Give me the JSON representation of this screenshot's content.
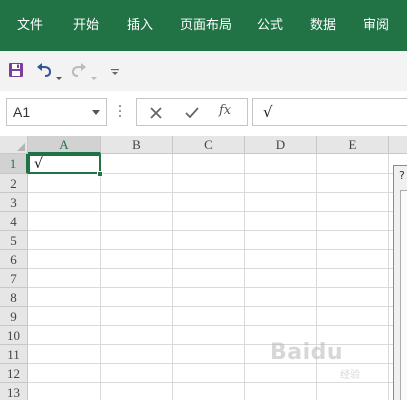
{
  "ribbon": {
    "tabs": [
      {
        "label": "文件"
      },
      {
        "label": "开始"
      },
      {
        "label": "插入"
      },
      {
        "label": "页面布局"
      },
      {
        "label": "公式"
      },
      {
        "label": "数据"
      },
      {
        "label": "审阅"
      }
    ],
    "bg_color": "#217346"
  },
  "quick_access": {
    "icons": [
      "save-icon",
      "undo-icon",
      "undo-dropdown-icon",
      "redo-icon",
      "redo-dropdown-icon",
      "customize-qat-icon"
    ]
  },
  "formula_bar": {
    "namebox_value": "A1",
    "cancel_icon": "cancel-icon",
    "enter_icon": "enter-icon",
    "fx_label": "fx",
    "content": "√"
  },
  "sheet": {
    "columns": [
      "A",
      "B",
      "C",
      "D",
      "E"
    ],
    "rows": [
      "1",
      "2",
      "3",
      "4",
      "5",
      "6",
      "7",
      "8",
      "9",
      "10",
      "11",
      "12",
      "13"
    ],
    "active_cell": "A1",
    "cells": {
      "A1": "√"
    },
    "accent_color": "#217346"
  },
  "dialog": {
    "title_fragment": "?"
  },
  "watermark": {
    "text": "Baidu",
    "sub": "经验"
  }
}
